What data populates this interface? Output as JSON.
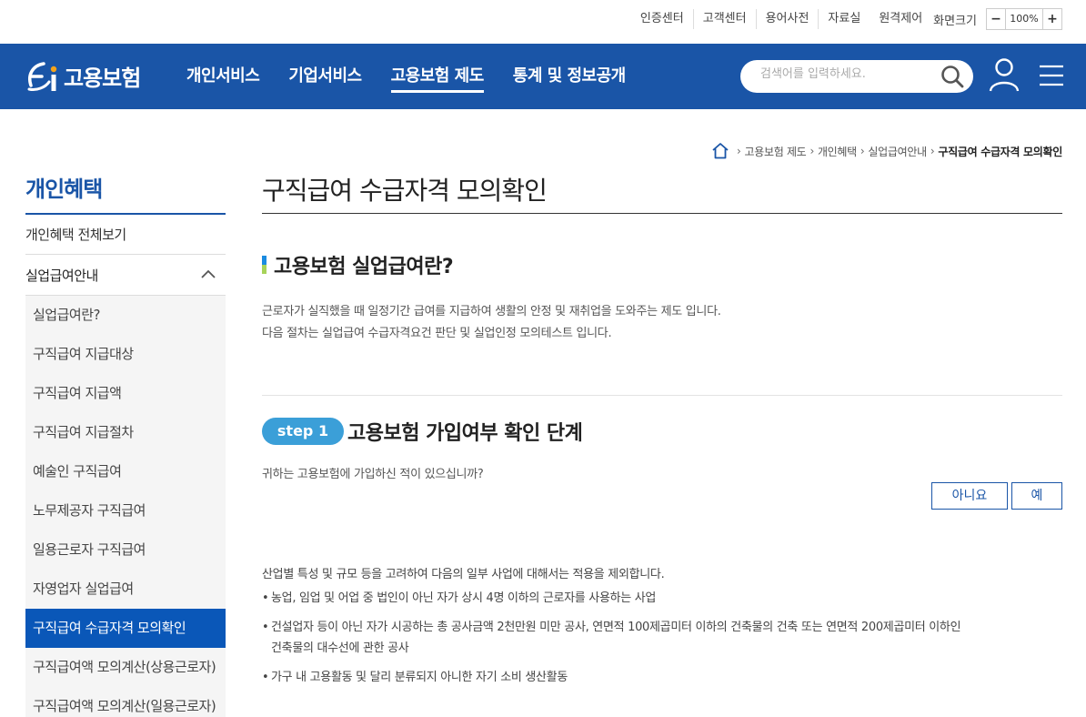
{
  "util": {
    "links": [
      "인증센터",
      "고객센터",
      "용어사전",
      "자료실",
      "원격제어"
    ],
    "zoom_label": "화면크기",
    "zoom_minus": "−",
    "zoom_value": "100%",
    "zoom_plus": "+"
  },
  "header": {
    "logo_text": "고용보험",
    "menu": [
      "개인서비스",
      "기업서비스",
      "고용보험 제도",
      "통계 및 정보공개"
    ],
    "active_menu_index": 2,
    "search_placeholder": "검색어를 입력하세요.",
    "brand_color": "#1a55a7"
  },
  "breadcrumb": [
    "고용보험 제도",
    "개인혜택",
    "실업급여안내",
    "구직급여 수급자격 모의확인"
  ],
  "sidebar": {
    "title": "개인혜택",
    "top_item": "개인혜택 전체보기",
    "group_label": "실업급여안내",
    "sub_items": [
      "실업급여란?",
      "구직급여 지급대상",
      "구직급여 지급액",
      "구직급여 지급절차",
      "예술인 구직급여",
      "노무제공자 구직급여",
      "일용근로자 구직급여",
      "자영업자 실업급여",
      "구직급여 수급자격 모의확인",
      "구직급여액 모의계산(상용근로자)",
      "구직급여액 모의계산(일용근로자)"
    ],
    "active_index": 8
  },
  "main": {
    "page_title": "구직급여 수급자격 모의확인",
    "section_title": "고용보험 실업급여란?",
    "desc_line1": "근로자가 실직했을 때 일정기간 급여를 지급하여 생활의 안정 및 재취업을 도와주는 제도 입니다.",
    "desc_line2": "다음 절차는 실업급여 수급자격요건 판단 및 실업인정 모의테스트 입니다.",
    "step_label": "step 1",
    "step_title": "고용보험 가입여부 확인 단계",
    "question": "귀하는 고용보험에 가입하신 적이 있으십니까?",
    "btn_no": "아니요",
    "btn_yes": "예",
    "notice_lead": "산업별 특성 및 규모 등을 고려하여 다음의 일부 사업에 대해서는 적용을 제외합니다.",
    "notice_bullets": [
      "농업, 임업 및 어업 중 법인이 아닌 자가 상시 4명 이하의 근로자를 사용하는 사업",
      "건설업자 등이 아닌 자가 시공하는 총 공사금액 2천만원 미만 공사, 연면적 100제곱미터 이하의 건축물의 건축 또는 연면적 200제곱미터 이하인",
      "건축물의 대수선에 관한 공사",
      "가구 내 고용활동 및 달리 분류되지 아니한 자기 소비 생산활동"
    ]
  }
}
